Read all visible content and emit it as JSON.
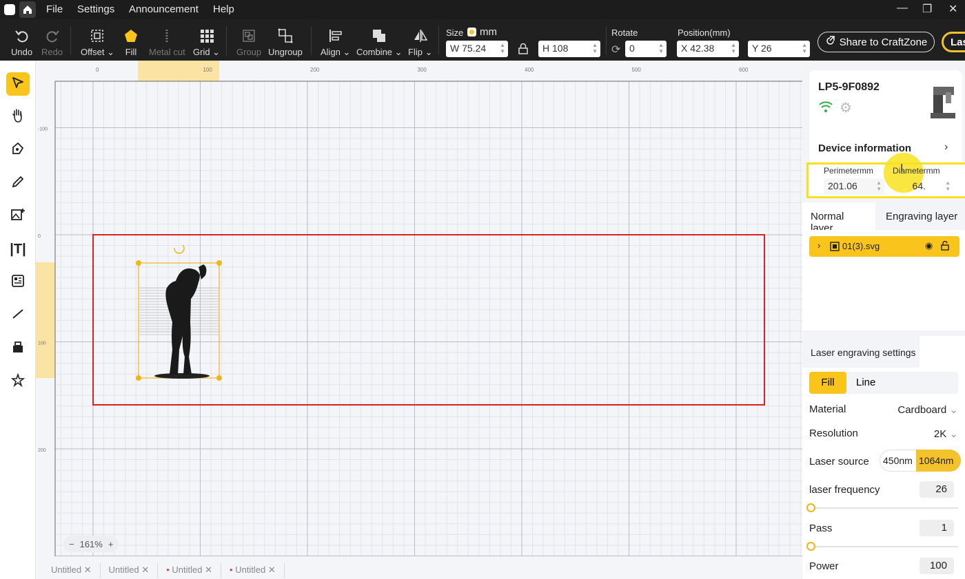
{
  "titlebar": {
    "menu": [
      "File",
      "Settings",
      "Announcement",
      "Help"
    ]
  },
  "toolbar": {
    "undo": "Undo",
    "redo": "Redo",
    "offset": "Offset",
    "fill": "Fill",
    "metal_cut": "Metal cut",
    "grid": "Grid",
    "group": "Group",
    "ungroup": "Ungroup",
    "align": "Align",
    "combine": "Combine",
    "flip": "Flip",
    "size_label": "Size",
    "unit": "mm",
    "width_prefix": "W",
    "width": "75.24",
    "height_prefix": "H",
    "height": "108",
    "rotate_label": "Rotate",
    "rotate": "0",
    "position_label": "Position(mm)",
    "x_prefix": "X",
    "x": "42.38",
    "y_prefix": "Y",
    "y": "26",
    "share": "Share to CraftZone",
    "laser_btn": "Las"
  },
  "ruler": {
    "top_ticks": [
      "0",
      "100",
      "200",
      "300",
      "400",
      "500",
      "600"
    ],
    "left_ticks": [
      "-100",
      "0",
      "100",
      "200"
    ]
  },
  "canvas": {
    "zoom": "161%",
    "tabs": [
      {
        "label": "Untitled",
        "unsaved": false
      },
      {
        "label": "Untitled",
        "unsaved": false
      },
      {
        "label": "Untitled",
        "unsaved": true
      },
      {
        "label": "Untitled",
        "unsaved": true
      }
    ]
  },
  "device": {
    "name": "LP5-9F0892",
    "info_label": "Device information",
    "perimeter_label": "Perimetermm",
    "perimeter": "201.06",
    "diameter_label": "Diametermm",
    "diameter": "64."
  },
  "layers": {
    "tab_normal": "Normal layer",
    "tab_engraving": "Engraving layer",
    "item": "01(3).svg"
  },
  "laser_settings": {
    "title": "Laser engraving settings",
    "mode_fill": "Fill",
    "mode_line": "Line",
    "material_label": "Material",
    "material": "Cardboard",
    "resolution_label": "Resolution",
    "resolution": "2K",
    "source_label": "Laser source",
    "source_a": "450nm",
    "source_b": "1064nm",
    "frequency_label": "laser frequency",
    "frequency": "26",
    "pass_label": "Pass",
    "pass": "1",
    "power_label": "Power",
    "power": "100"
  },
  "colors": {
    "accent": "#f9c41b",
    "frame": "#e02020",
    "highlight": "#f7e21d"
  }
}
